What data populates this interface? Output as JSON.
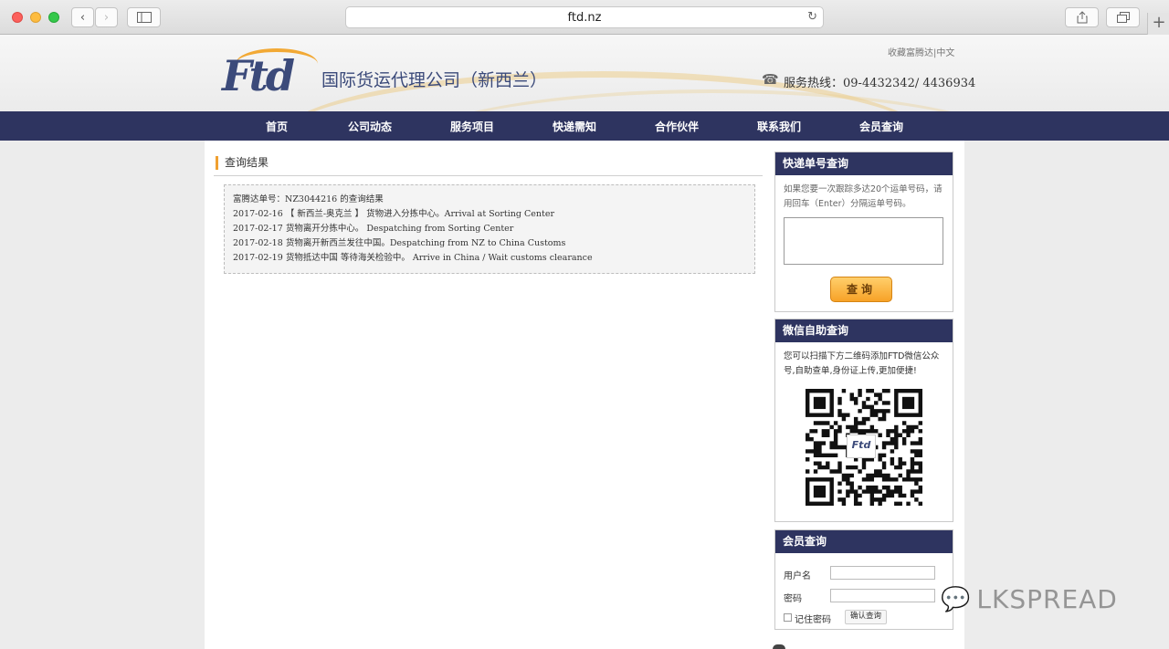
{
  "browser": {
    "url": "ftd.nz"
  },
  "header": {
    "logo": "Ftd",
    "company_name": "国际货运代理公司（新西兰）",
    "top_links": "收藏富腾达|中文",
    "hotline_label": "服务热线：",
    "hotline_numbers": "09-4432342/ 4436934"
  },
  "nav": [
    "首页",
    "公司动态",
    "服务项目",
    "快递需知",
    "合作伙伴",
    "联系我们",
    "会员查询"
  ],
  "result": {
    "title": "查询结果",
    "header_line": "富腾达单号：NZ3044216 的查询结果",
    "events": [
      {
        "date": "2017-02-16",
        "text": "【 新西兰-奥克兰 】 货物进入分拣中心。Arrival at Sorting Center"
      },
      {
        "date": "2017-02-17",
        "text": "货物离开分拣中心。 Despatching from Sorting Center"
      },
      {
        "date": "2017-02-18",
        "text": "货物离开新西兰发往中国。Despatching from NZ to China Customs"
      },
      {
        "date": "2017-02-19",
        "text": "货物抵达中国 等待海关检验中。 Arrive in China / Wait customs clearance"
      }
    ]
  },
  "tracking": {
    "title": "快递单号查询",
    "hint": "如果您要一次跟踪多达20个运单号码，请用回车（Enter）分隔运单号码。",
    "button": "查询"
  },
  "wechat": {
    "title": "微信自助查询",
    "text": "您可以扫描下方二维码添加FTD微信公众号,自助查单,身份证上传,更加便捷!",
    "qr_logo": "Ftd"
  },
  "member": {
    "title": "会员查询",
    "username_label": "用户名",
    "password_label": "密码",
    "remember_label": "记住密码",
    "confirm_button": "确认查询"
  },
  "watermark": "LKSPREAD"
}
